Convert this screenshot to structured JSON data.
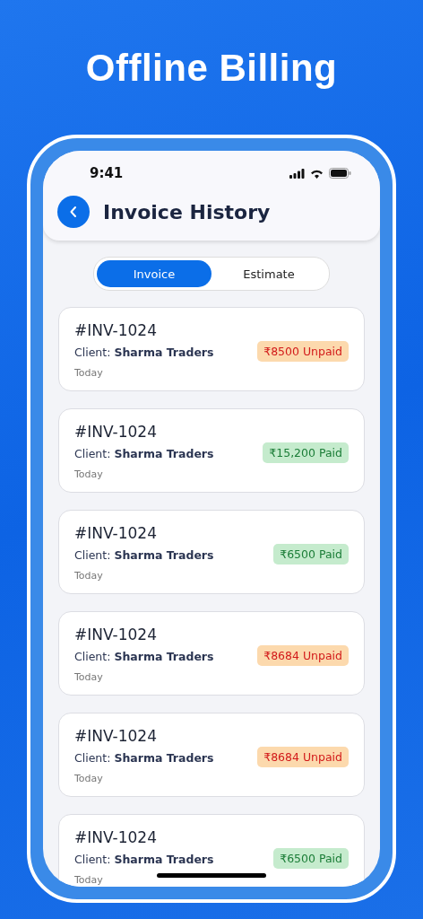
{
  "headline": "Offline Billing",
  "status_bar": {
    "time": "9:41"
  },
  "header": {
    "title": "Invoice History"
  },
  "tabs": [
    {
      "label": "Invoice",
      "selected": true
    },
    {
      "label": "Estimate",
      "selected": false
    }
  ],
  "invoices": [
    {
      "number": "#INV-1024",
      "client": "Client: **Sharma Traders**",
      "date": "Today",
      "amount": "₹8500 Unpaid",
      "kind": "unpaid"
    },
    {
      "number": "#INV-1024",
      "client": "Client: **Sharma Traders**",
      "date": "Today",
      "amount": "₹15,200 Paid",
      "kind": "paid"
    },
    {
      "number": "#INV-1024",
      "client": "Client: **Sharma Traders**",
      "date": "Today",
      "amount": "₹6500 Paid",
      "kind": "paid"
    },
    {
      "number": "#INV-1024",
      "client": "Client: **Sharma Traders**",
      "date": "Today",
      "amount": "₹8684 Unpaid",
      "kind": "unpaid"
    },
    {
      "number": "#INV-1024",
      "client": "Client: **Sharma Traders**",
      "date": "Today",
      "amount": "₹8684 Unpaid",
      "kind": "unpaid"
    },
    {
      "number": "#INV-1024",
      "client": "Client: **Sharma Traders**",
      "date": "Today",
      "amount": "₹6500 Paid",
      "kind": "paid"
    }
  ]
}
